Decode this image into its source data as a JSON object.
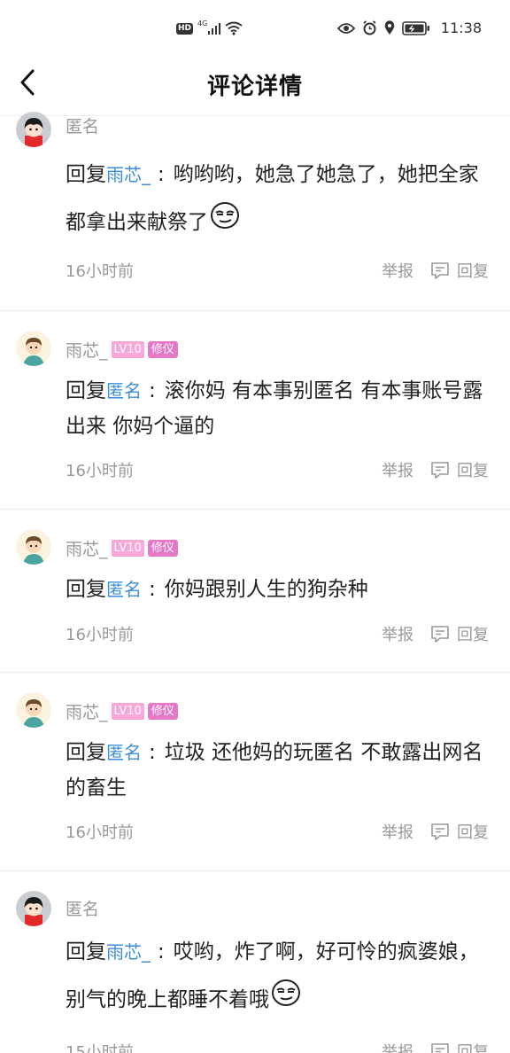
{
  "status_bar": {
    "left_badges": [
      "HD",
      "4G"
    ],
    "time": "11:38"
  },
  "header": {
    "title": "评论详情",
    "back_icon": "chevron-left-icon"
  },
  "actions": {
    "report_label": "举报",
    "reply_label": "回复",
    "reply_prefix": "回复"
  },
  "comments": [
    {
      "author": "匿名",
      "reply_to": "雨芯_",
      "text": "哟哟哟，她急了她急了，她把全家都拿出来献祭了",
      "time": "16小时前",
      "emoji": "smirk-face"
    },
    {
      "author": "雨芯_",
      "level": "LV10",
      "title_badge": "修仪",
      "reply_to": "匿名",
      "text": "滚你妈 有本事别匿名 有本事账号露出来 你妈个逼的",
      "time": "16小时前"
    },
    {
      "author": "雨芯_",
      "level": "LV10",
      "title_badge": "修仪",
      "reply_to": "匿名",
      "text": "你妈跟别人生的狗杂种",
      "time": "16小时前"
    },
    {
      "author": "雨芯_",
      "level": "LV10",
      "title_badge": "修仪",
      "reply_to": "匿名",
      "text": "垃圾 还他妈的玩匿名 不敢露出网名的畜生",
      "time": "16小时前"
    },
    {
      "author": "匿名",
      "reply_to": "雨芯_",
      "text": "哎哟，炸了啊，好可怜的疯婆娘，别气的晚上都睡不着哦",
      "time": "15小时前",
      "emoji": "smirk-face"
    }
  ]
}
